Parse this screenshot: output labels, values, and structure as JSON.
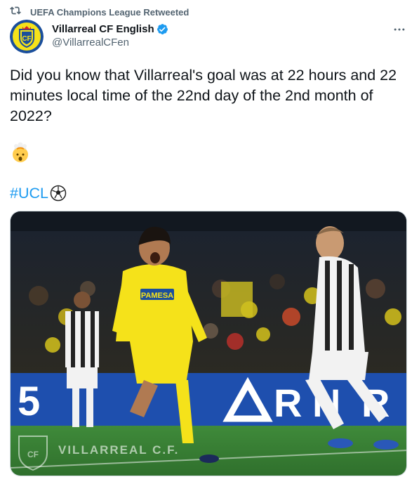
{
  "social_context": {
    "text": "UEFA Champions League Retweeted"
  },
  "author": {
    "name": "Villarreal CF English",
    "handle": "@VillarrealCFen",
    "verified": true
  },
  "tweet": {
    "text": "Did you know that Villarreal's goal was at 22 hours and 22 minutes local time of the 22nd day of the 2nd month of 2022?",
    "emoji": "🤯",
    "hashtag": "#UCL",
    "hashtag_emoji": "⚽"
  },
  "media": {
    "description_icon": "photo",
    "watermark": "VILLARREAL C.F.",
    "board_text": "5 | ∆ R N R",
    "shirt_text": "PAMESA"
  },
  "colors": {
    "accent": "#1d9bf0",
    "muted": "#536471",
    "text": "#0f1419",
    "kit_yellow": "#f5e21a"
  }
}
